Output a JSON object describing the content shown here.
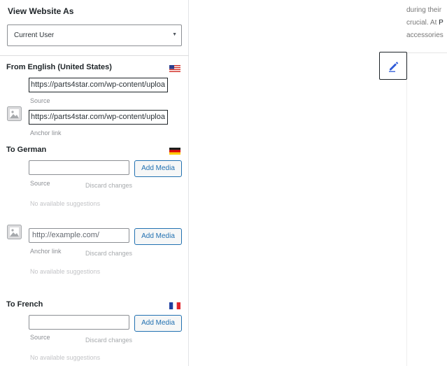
{
  "sidebar": {
    "title": "View Website As",
    "view_as_value": "Current User",
    "source_language": {
      "label": "From English (United States)",
      "source_url": "https://parts4star.com/wp-content/uploa",
      "source_label": "Source",
      "anchor_url": "https://parts4star.com/wp-content/uploa",
      "anchor_label": "Anchor link"
    },
    "german": {
      "label": "To German",
      "source_value": "",
      "add_media": "Add Media",
      "source_label": "Source",
      "discard": "Discard changes",
      "no_suggestions": "No available suggestions",
      "anchor_placeholder": "http://example.com/",
      "anchor_add_media": "Add Media",
      "anchor_label": "Anchor link",
      "anchor_discard": "Discard changes",
      "anchor_no_suggestions": "No available suggestions"
    },
    "french": {
      "label": "To French",
      "source_value": "",
      "add_media": "Add Media",
      "source_label": "Source",
      "discard": "Discard changes",
      "no_suggestions": "No available suggestions"
    }
  },
  "preview": {
    "line1": "during their",
    "line2_prefix": "crucial. At ",
    "line2_link": "P",
    "line3": "accessories"
  },
  "icons": {
    "dropdown": "chevron-down-icon",
    "us_flag": "us-flag-icon",
    "de_flag": "german-flag-icon",
    "fr_flag": "french-flag-icon",
    "image": "image-placeholder-icon",
    "edit": "pencil-icon"
  },
  "colors": {
    "accent": "#2271b1",
    "edit_icon": "#2f5bd8"
  }
}
